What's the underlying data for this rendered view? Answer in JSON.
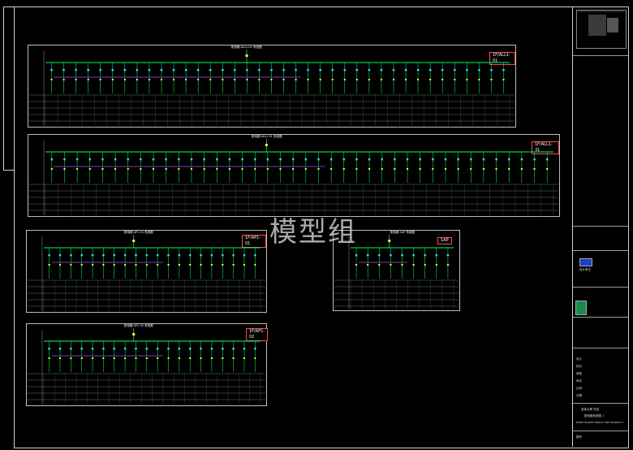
{
  "watermark": "模型组",
  "panels": [
    {
      "id": "p1",
      "tag": "1F/ALL1-01",
      "header": "配电箱 ALL1-01 系统图",
      "circuits": 38
    },
    {
      "id": "p2",
      "tag": "1F/ALL1-31",
      "header": "配电箱 ALL1-31 系统图",
      "circuits": 40
    },
    {
      "id": "p3",
      "tag": "1F/AP1-01",
      "header": "配电箱 AP1-01 系统图",
      "circuits": 20
    },
    {
      "id": "p4",
      "tag": "1AP",
      "header": "配电箱 1AP 系统图",
      "circuits": 9
    },
    {
      "id": "p5",
      "tag": "1F/AP1-02",
      "header": "配电箱 AP1-02 系统图",
      "circuits": 20
    }
  ],
  "titleblock": {
    "company": "设计单位",
    "project": "某某大厦 项目",
    "drawing_title": "配电箱系统图 1",
    "drawing_title_en": "PANEL BOARD SINGLE LINE DIAGRAM 1",
    "labels": [
      "设计",
      "校对",
      "审核",
      "审定",
      "比例",
      "日期",
      "图号"
    ]
  },
  "colors": {
    "bus": "#00ff66",
    "phase": "#ffff33",
    "feeder": "#a050ff",
    "breaker": "#33ddff",
    "frame": "#cfcfcf",
    "tag": "#ff4d4d"
  }
}
